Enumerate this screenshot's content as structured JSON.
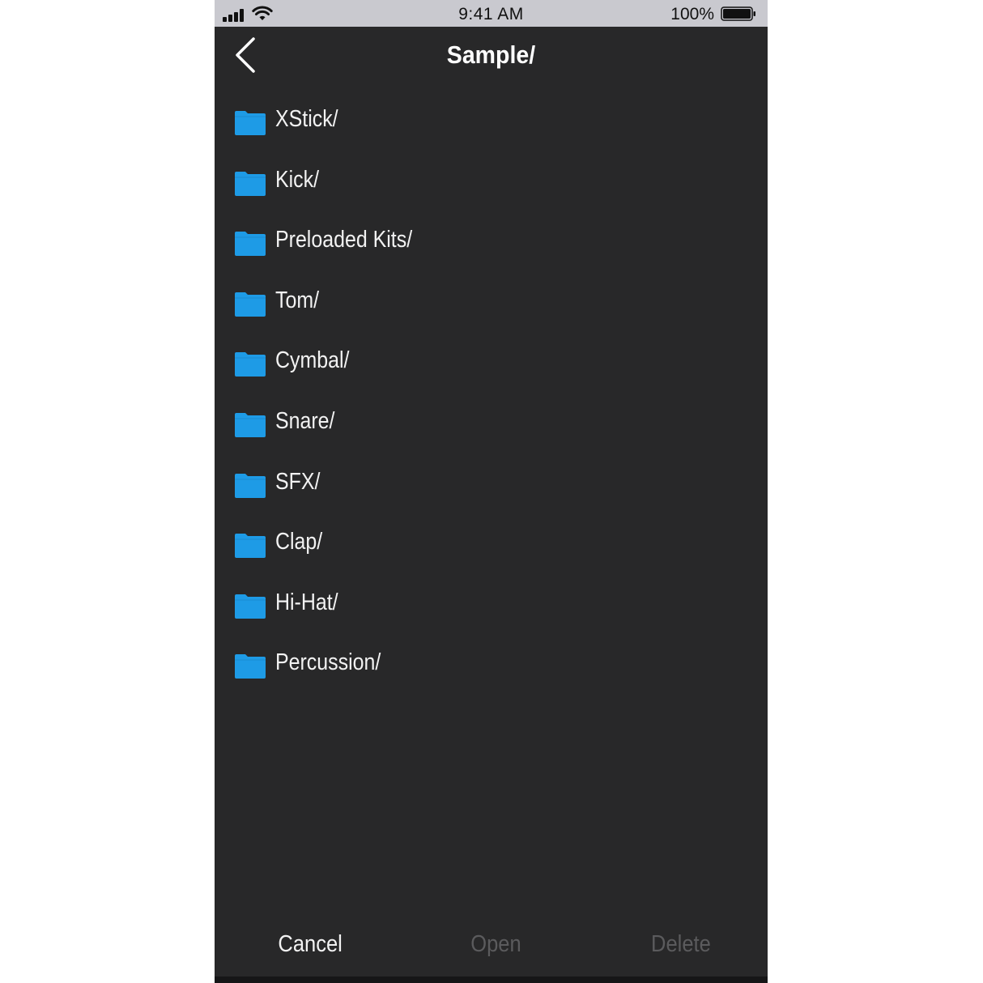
{
  "status_bar": {
    "time": "9:41 AM",
    "battery_percent": "100%",
    "battery_level": 1.0,
    "signal_icon": "cellular-signal-icon",
    "wifi_icon": "wifi-icon",
    "battery_icon": "battery-icon"
  },
  "nav": {
    "title": "Sample/",
    "back_icon": "chevron-left-icon"
  },
  "folders": [
    {
      "name": "XStick/",
      "icon": "folder-icon"
    },
    {
      "name": "Kick/",
      "icon": "folder-icon"
    },
    {
      "name": "Preloaded Kits/",
      "icon": "folder-icon"
    },
    {
      "name": "Tom/",
      "icon": "folder-icon"
    },
    {
      "name": "Cymbal/",
      "icon": "folder-icon"
    },
    {
      "name": "Snare/",
      "icon": "folder-icon"
    },
    {
      "name": "SFX/",
      "icon": "folder-icon"
    },
    {
      "name": "Clap/",
      "icon": "folder-icon"
    },
    {
      "name": "Hi-Hat/",
      "icon": "folder-icon"
    },
    {
      "name": "Percussion/",
      "icon": "folder-icon"
    }
  ],
  "actions": {
    "cancel": "Cancel",
    "open": "Open",
    "delete": "Delete"
  },
  "colors": {
    "background": "#282829",
    "folder": "#1e9be6",
    "text": "#f2f2f2",
    "disabled_text": "#5b5b5d",
    "status_bar": "#c9c9cf"
  }
}
